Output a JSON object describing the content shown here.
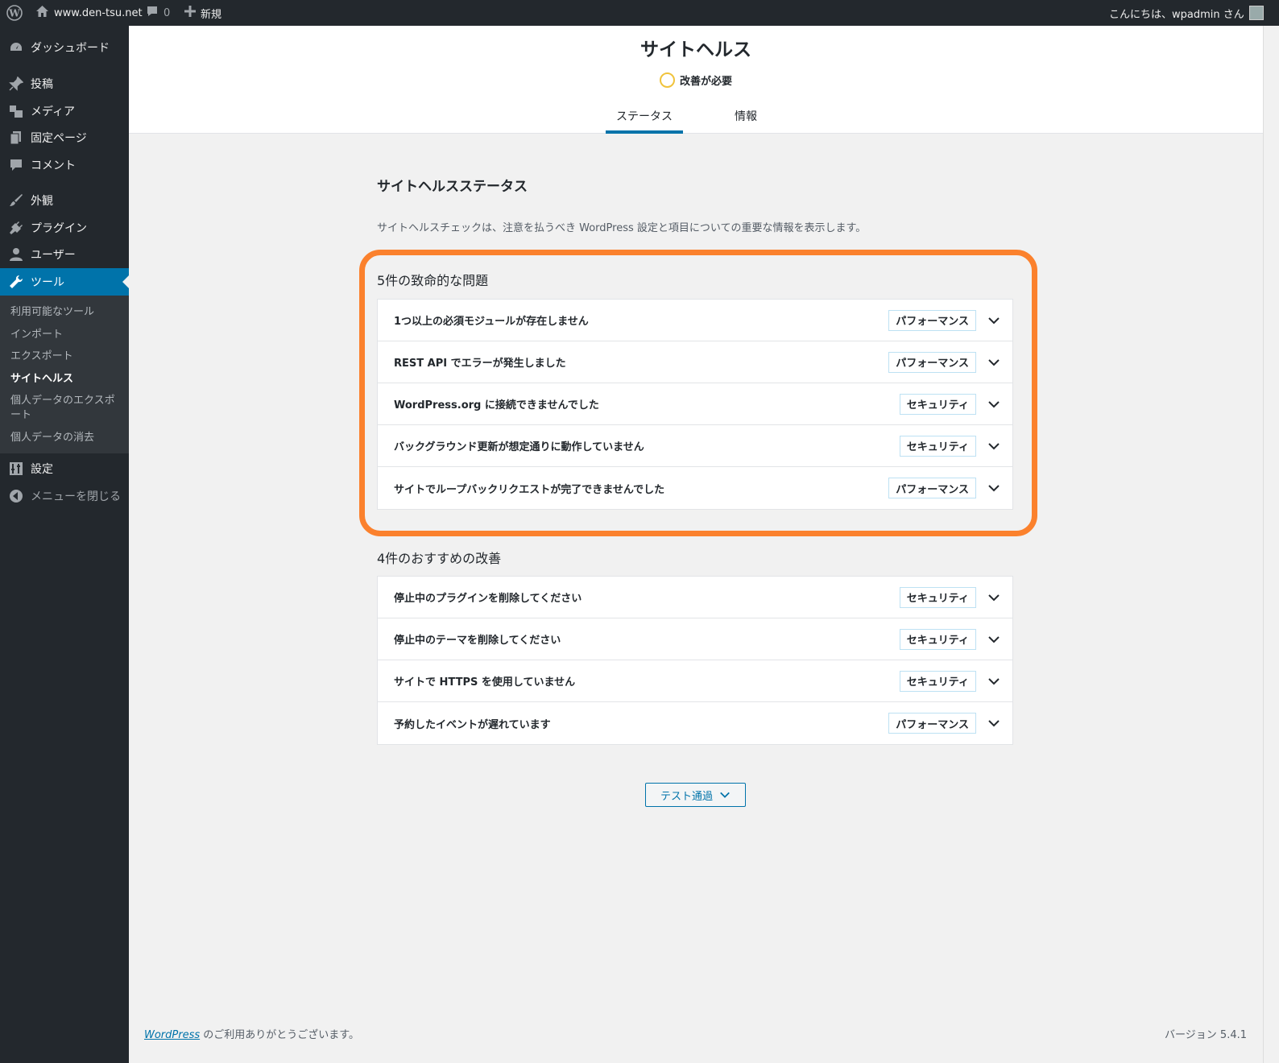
{
  "adminbar": {
    "site_name": "www.den-tsu.net",
    "comments_count": "0",
    "new_label": "新規",
    "greeting": "こんにちは、wpadmin さん"
  },
  "sidebar": {
    "items": [
      {
        "label": "ダッシュボード",
        "icon": "dashboard-icon"
      },
      {
        "label": "投稿",
        "icon": "pin-icon"
      },
      {
        "label": "メディア",
        "icon": "media-icon"
      },
      {
        "label": "固定ページ",
        "icon": "page-icon"
      },
      {
        "label": "コメント",
        "icon": "comment-icon"
      },
      {
        "label": "外観",
        "icon": "brush-icon"
      },
      {
        "label": "プラグイン",
        "icon": "plugin-icon"
      },
      {
        "label": "ユーザー",
        "icon": "user-icon"
      },
      {
        "label": "ツール",
        "icon": "wrench-icon"
      },
      {
        "label": "設定",
        "icon": "settings-icon"
      },
      {
        "label": "メニューを閉じる",
        "icon": "collapse-icon"
      }
    ],
    "submenu": [
      "利用可能なツール",
      "インポート",
      "エクスポート",
      "サイトヘルス",
      "個人データのエクスポート",
      "個人データの消去"
    ]
  },
  "header": {
    "title": "サイトヘルス",
    "status": "改善が必要",
    "tabs": [
      "ステータス",
      "情報"
    ]
  },
  "main": {
    "section_title": "サイトヘルスステータス",
    "description": "サイトヘルスチェックは、注意を払うべき WordPress 設定と項目についての重要な情報を表示します。",
    "critical": {
      "title": "5件の致命的な問題",
      "items": [
        {
          "label": "1つ以上の必須モジュールが存在しません",
          "badge": "パフォーマンス"
        },
        {
          "label": "REST API でエラーが発生しました",
          "badge": "パフォーマンス"
        },
        {
          "label": "WordPress.org に接続できませんでした",
          "badge": "セキュリティ"
        },
        {
          "label": "バックグラウンド更新が想定通りに動作していません",
          "badge": "セキュリティ"
        },
        {
          "label": "サイトでループバックリクエストが完了できませんでした",
          "badge": "パフォーマンス"
        }
      ]
    },
    "recommended": {
      "title": "4件のおすすめの改善",
      "items": [
        {
          "label": "停止中のプラグインを削除してください",
          "badge": "セキュリティ"
        },
        {
          "label": "停止中のテーマを削除してください",
          "badge": "セキュリティ"
        },
        {
          "label": "サイトで HTTPS を使用していません",
          "badge": "セキュリティ"
        },
        {
          "label": "予約したイベントが遅れています",
          "badge": "パフォーマンス"
        }
      ]
    },
    "passed_button": "テスト通過"
  },
  "footer": {
    "link": "WordPress",
    "thanks": " のご利用ありがとうございます。",
    "version": "バージョン 5.4.1"
  },
  "colors": {
    "accent": "#0073aa",
    "highlight": "#fb812d",
    "status_ring": "#f0c33c",
    "sidebar_bg": "#23282d"
  }
}
